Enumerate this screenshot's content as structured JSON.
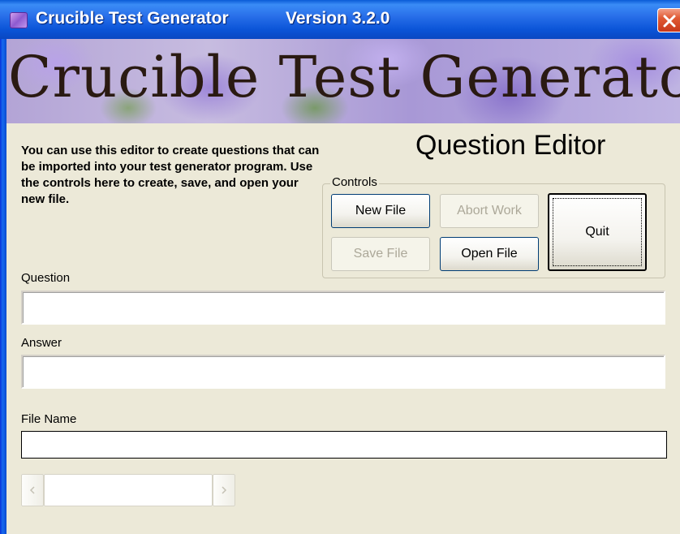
{
  "titlebar": {
    "title": "Crucible Test Generator",
    "version": "Version 3.2.0",
    "icon": "app-icon",
    "close_icon": "close-icon"
  },
  "banner": {
    "text": "Crucible Test Generator"
  },
  "editor": {
    "heading": "Question Editor",
    "description": "You can use this editor to create questions that can be imported into your test generator program.  Use the controls here to create, save, and open your new file."
  },
  "controls": {
    "legend": "Controls",
    "new_file": "New File",
    "abort_work": "Abort Work",
    "save_file": "Save File",
    "open_file": "Open File",
    "quit": "Quit"
  },
  "fields": {
    "question_label": "Question",
    "question_value": "",
    "answer_label": "Answer",
    "answer_value": "",
    "file_name_label": "File Name",
    "file_name_value": ""
  },
  "scrollbar": {
    "left_icon": "arrow-left-icon",
    "right_icon": "arrow-right-icon"
  },
  "colors": {
    "titlebar": "#0a55d8",
    "window_bg": "#ece9d8",
    "close": "#e05a34"
  }
}
